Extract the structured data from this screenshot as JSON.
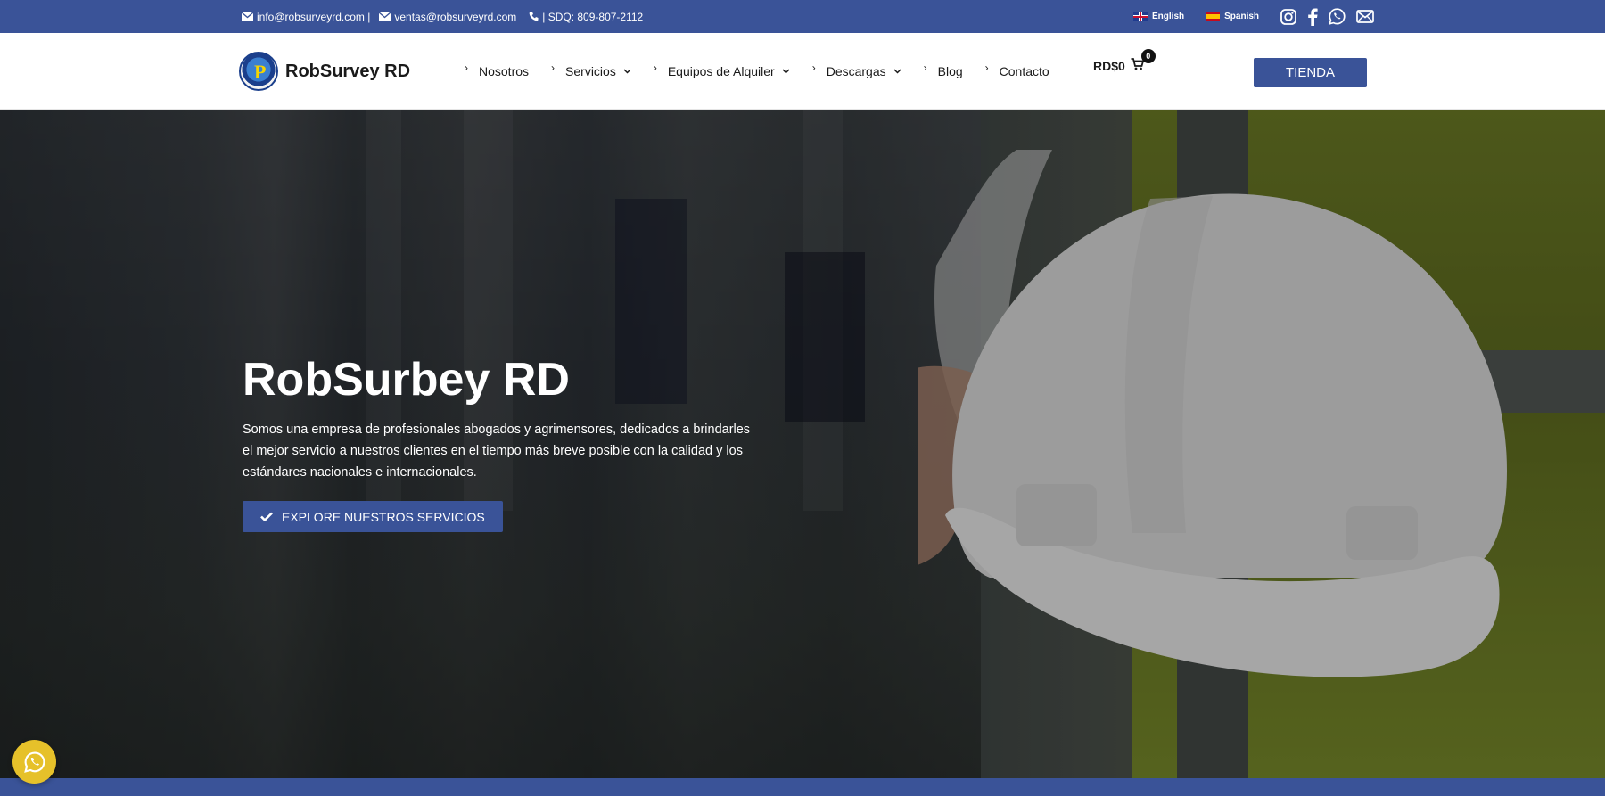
{
  "topbar": {
    "email_info": "info@robsurveyrd.com |",
    "email_ventas": "ventas@robsurveyrd.com",
    "phone": "| SDQ: 809-807-2112",
    "lang_english": "English",
    "lang_spanish": "Spanish",
    "social_icons": [
      "instagram-icon",
      "facebook-icon",
      "whatsapp-icon",
      "mail-icon"
    ]
  },
  "header": {
    "logo_text": "RobSurvey RD",
    "nav": [
      {
        "label": "Nosotros",
        "dropdown": false
      },
      {
        "label": "Servicios",
        "dropdown": true
      },
      {
        "label": "Equipos de Alquiler",
        "dropdown": true
      },
      {
        "label": "Descargas",
        "dropdown": true
      },
      {
        "label": "Blog",
        "dropdown": false
      },
      {
        "label": "Contacto",
        "dropdown": false
      }
    ],
    "cart_total": "RD$0",
    "cart_count": "0",
    "shop_button": "TIENDA"
  },
  "hero": {
    "title": "RobSurbey RD",
    "description": "Somos una empresa de profesionales abogados y agrimensores, dedicados a brindarles el mejor servicio a nuestros clientes en el tiempo más breve posible con la calidad y los estándares nacionales e internacionales.",
    "cta": "EXPLORE NUESTROS SERVICIOS"
  },
  "colors": {
    "primary": "#3a5398",
    "whatsapp_float": "#e6c12a"
  }
}
